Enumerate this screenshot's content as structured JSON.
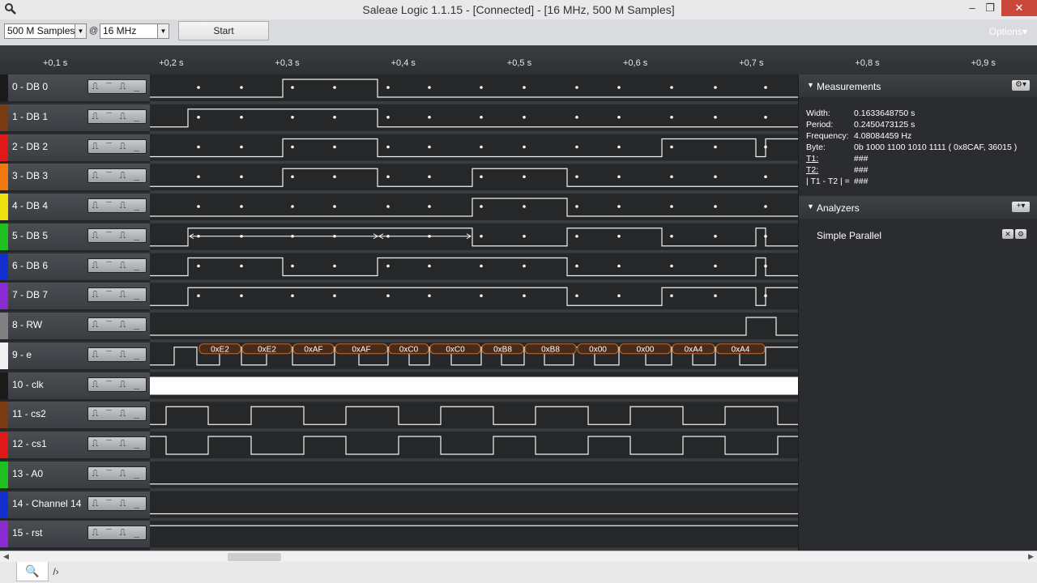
{
  "window": {
    "title": "Saleae Logic 1.1.15 - [Connected] - [16 MHz, 500 M Samples]",
    "minimize": "‒",
    "restore": "❐",
    "close": "✕"
  },
  "toolbar": {
    "samples": "500 M Samples",
    "at": "@",
    "rate": "16 MHz",
    "start_label": "Start",
    "options_label": "Options▾"
  },
  "ruler": {
    "ticks": [
      "+0,1 s",
      "+0,2 s",
      "+0,3 s",
      "+0,4 s",
      "+0,5 s",
      "+0,6 s",
      "+0,7 s",
      "+0,8 s",
      "+0,9 s"
    ]
  },
  "channels": [
    {
      "name": "0 - DB 0",
      "color": "#1a1a1a"
    },
    {
      "name": "1 - DB 1",
      "color": "#7a3b10"
    },
    {
      "name": "2 - DB 2",
      "color": "#e01818"
    },
    {
      "name": "3 - DB 3",
      "color": "#f07a10"
    },
    {
      "name": "4 - DB 4",
      "color": "#f0e010"
    },
    {
      "name": "5 - DB 5",
      "color": "#20c020"
    },
    {
      "name": "6 - DB 6",
      "color": "#1030d0"
    },
    {
      "name": "7 - DB 7",
      "color": "#8a2ad0"
    },
    {
      "name": "8 - RW",
      "color": "#808080"
    },
    {
      "name": "9 - e",
      "color": "#f0f0f0"
    },
    {
      "name": "10 - clk",
      "color": "#1a1a1a"
    },
    {
      "name": "11 - cs2",
      "color": "#7a3b10"
    },
    {
      "name": "12 - cs1",
      "color": "#e01818"
    },
    {
      "name": "13 - A0",
      "color": "#20c020"
    },
    {
      "name": "14 - Channel 14",
      "color": "#1030d0"
    },
    {
      "name": "15 - rst",
      "color": "#8a2ad0"
    }
  ],
  "trigger_glyphs": [
    "⎍",
    "‾",
    "⎍",
    "_"
  ],
  "decoded_bytes": [
    "0xE2",
    "0xE2",
    "0xAF",
    "0xAF",
    "0xC0",
    "0xC0",
    "0xB8",
    "0xB8",
    "0x00",
    "0x00",
    "0xA4",
    "0xA4"
  ],
  "panel": {
    "measurements_label": "Measurements",
    "analyzers_label": "Analyzers",
    "gear_btn": "⚙▾",
    "add_btn": "+▾",
    "width_label": "Width:",
    "width_val": "0.1633648750 s",
    "period_label": "Period:",
    "period_val": "0.2450473125 s",
    "freq_label": "Frequency:",
    "freq_val": "4.08084459 Hz",
    "byte_label": "Byte:",
    "byte_val": "0b  1000  1100  1010  1111 ( 0x8CAF, 36015 )",
    "t1_label": "T1:",
    "t1_val": "###",
    "t2_label": "T2:",
    "t2_val": "###",
    "diff_label": "| T1 - T2 | =",
    "diff_val": "###",
    "analyzer_name": "Simple Parallel",
    "close_btn": "✕",
    "settings_btn": "⚙",
    "collapse": "▼"
  },
  "scroll": {
    "left": "◀",
    "right": "▶"
  },
  "tabs": {
    "search": "🔍",
    "more": "/›"
  }
}
